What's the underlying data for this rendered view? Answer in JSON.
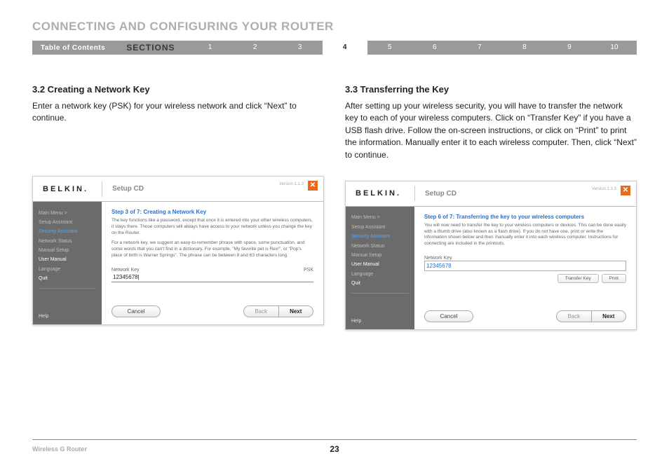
{
  "page_title": "CONNECTING AND CONFIGURING YOUR ROUTER",
  "nav": {
    "toc_label": "Table of Contents",
    "sections_label": "SECTIONS",
    "items": [
      "1",
      "2",
      "3",
      "4",
      "5",
      "6",
      "7",
      "8",
      "9",
      "10"
    ],
    "active_index": 3
  },
  "left": {
    "heading": "3.2 Creating a Network Key",
    "body": "Enter a network key (PSK) for your wireless network and click “Next” to continue.",
    "shot": {
      "logo": "BELKIN.",
      "header_mid": "Setup CD",
      "version": "Version 1.1.3",
      "close": "✕",
      "sidebar": [
        {
          "label": "Main Menu  >",
          "cls": ""
        },
        {
          "label": "Setup Assistant",
          "cls": ""
        },
        {
          "label": "Security Assistant",
          "cls": "hl-blue"
        },
        {
          "label": "Network Status",
          "cls": ""
        },
        {
          "label": "Manual Setup",
          "cls": ""
        },
        {
          "label": "User Manual",
          "cls": "hl-white"
        },
        {
          "label": "Language",
          "cls": ""
        },
        {
          "label": "Quit",
          "cls": "hl-white"
        }
      ],
      "help": "Help",
      "step_title": "Step 3 of 7: Creating a Network Key",
      "desc1": "The key functions like a password, except that once it is entered into your other wireless computers, it stays there. Those computers will always have access to your network unless you change the key on the Router.",
      "desc2": "For a network key, we suggest an easy-to-remember phrase with space, some punctuation, and some words that you can't find in a dictionary. For example, \"My favorite pet is Rex!\", or \"Pop's place of birth is Warner Springs\". The phrase can be between 8 and 63 characters long.",
      "field_label": "Network Key",
      "field_type": "PSK",
      "field_value": "12345678|",
      "cancel": "Cancel",
      "back": "Back",
      "next": "Next"
    }
  },
  "right": {
    "heading": "3.3 Transferring the Key",
    "body": "After setting up your wireless security, you will have to transfer the network key to each of your wireless computers. Click on “Transfer Key” if you have a USB flash drive. Follow the on-screen instructions, or click on “Print” to print the information. Manually enter it to each wireless computer. Then, click “Next” to continue.",
    "shot": {
      "logo": "BELKIN.",
      "header_mid": "Setup CD",
      "version": "Version 1.1.3",
      "close": "✕",
      "sidebar": [
        {
          "label": "Main Menu  >",
          "cls": ""
        },
        {
          "label": "Setup Assistant",
          "cls": ""
        },
        {
          "label": "Security Assistant",
          "cls": "hl-blue"
        },
        {
          "label": "Network Status",
          "cls": ""
        },
        {
          "label": "Manual Setup",
          "cls": ""
        },
        {
          "label": "User Manual",
          "cls": "hl-white"
        },
        {
          "label": "Language",
          "cls": ""
        },
        {
          "label": "Quit",
          "cls": "hl-white"
        }
      ],
      "help": "Help",
      "step_title": "Step 6 of 7: Transferring the key to your wireless computers",
      "desc1": "You will now need to transfer the key to your wireless computers or devices. This can be done easily with a thumb drive (also known as a flash drive). If you do not have one, print or write the information shown below and then manually enter it into each wireless computer. Instructions for connecting are included in the printouts.",
      "field_label": "Network Key",
      "field_value": "12345678",
      "transfer": "Transfer Key",
      "print": "Print",
      "cancel": "Cancel",
      "back": "Back",
      "next": "Next"
    }
  },
  "footer": {
    "product": "Wireless G Router",
    "page": "23"
  }
}
